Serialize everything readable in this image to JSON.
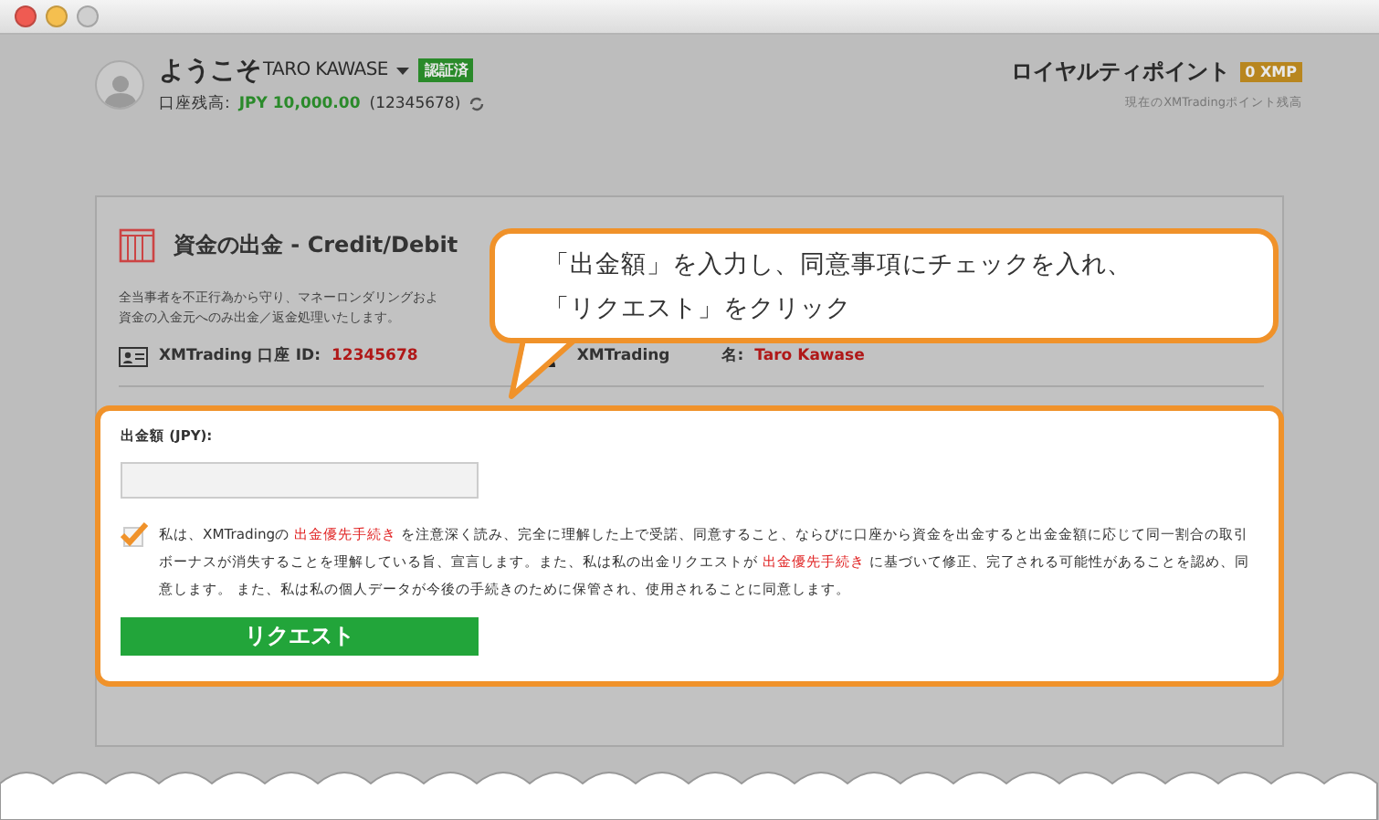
{
  "header": {
    "welcome": "ようこそ",
    "user_name": "TARO KAWASE",
    "verified_badge": "認証済",
    "balance_label": "口座残高:",
    "balance_value": "JPY 10,000.00",
    "account_number": "(12345678)",
    "loyalty_title": "ロイヤルティポイント",
    "loyalty_badge": "0 XMP",
    "loyalty_caption": "現在のXMTradingポイント残高"
  },
  "card": {
    "title": "資金の出金 - Credit/Debit",
    "description": [
      "全当事者を不正行為から守り、マネーロンダリングおよ",
      "資金の入金元へのみ出金／返金処理いたします。"
    ],
    "account_label": "XMTrading 口座 ID:",
    "account_id": "12345678",
    "owner_label_start": "XMTrading",
    "owner_label_end": "名:",
    "owner_name": "Taro Kawase"
  },
  "form": {
    "amount_label": "出金額 (JPY):",
    "agreement": {
      "checked": true,
      "parts": [
        {
          "kind": "text",
          "text": "私は、XMTradingの "
        },
        {
          "kind": "link",
          "text": "出金優先手続き"
        },
        {
          "kind": "text",
          "text": " を注意深く読み、完全に理解した上で受諾、同意すること、ならびに口座から資金を出金すると出金金額に応じて同一割合の取引ボーナスが消失することを理解している旨、宣言します。また、私は私の出金リクエストが "
        },
        {
          "kind": "link",
          "text": "出金優先手続き"
        },
        {
          "kind": "text",
          "text": " に基づいて修正、完了される可能性があることを認め、同意します。 また、私は私の個人データが今後の手続きのために保管され、使用されることに同意します。"
        }
      ]
    },
    "submit": "リクエスト"
  },
  "callout": {
    "lines": [
      "「出金額」を入力し、同意事項にチェックを入れ、",
      "「リクエスト」をクリック"
    ]
  }
}
